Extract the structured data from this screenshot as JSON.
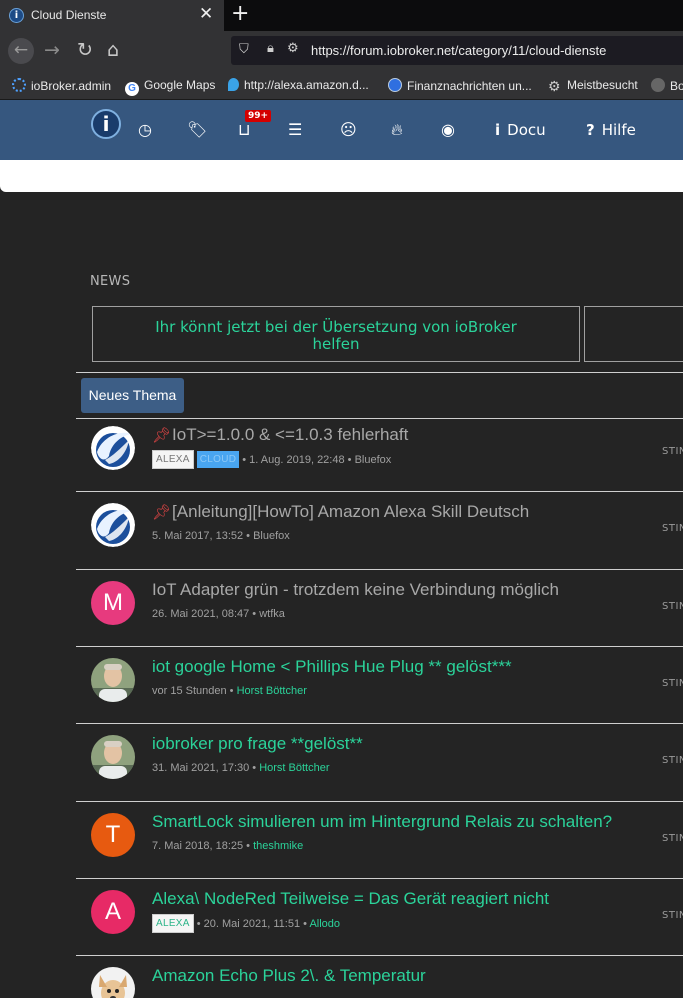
{
  "browser": {
    "tab_title": "Cloud Dienste",
    "url": "https://forum.iobroker.net/category/11/cloud-dienste",
    "bookmarks": [
      {
        "label": "ioBroker.admin",
        "icon": "gear-icon",
        "color": "#4ea1ff"
      },
      {
        "label": "Google Maps",
        "icon": "google-icon",
        "color": "#ffffff"
      },
      {
        "label": "http://alexa.amazon.d...",
        "icon": "location-pin-icon",
        "color": "#3aa3e8"
      },
      {
        "label": "Finanznachrichten un...",
        "icon": "finance-icon",
        "color": "#2f6fe0"
      },
      {
        "label": "Meistbesucht",
        "icon": "gear-icon",
        "color": "#cccccc"
      },
      {
        "label": "Bo",
        "icon": "globe-icon",
        "color": "#888888"
      }
    ]
  },
  "header": {
    "badge": "99+",
    "docu_label": "Docu",
    "hilfe_label": "Hilfe"
  },
  "news": {
    "label": "NEWS",
    "text": "Ihr könnt jetzt bei der Übersetzung von ioBroker helfen"
  },
  "new_topic_label": "Neues Thema",
  "topics": [
    {
      "title": "IoT>=1.0.0 & <=1.0.3 fehlerhaft",
      "pinned": true,
      "unread": false,
      "tags": [
        "ALEXA",
        "CLOUD"
      ],
      "timestamp": "1. Aug. 2019, 22:48",
      "author": "Bluefox",
      "avatar_type": "logo",
      "right": "STIN"
    },
    {
      "title": "[Anleitung][HowTo] Amazon Alexa Skill Deutsch",
      "pinned": true,
      "unread": false,
      "tags": [],
      "timestamp": "5. Mai 2017, 13:52",
      "author": "Bluefox",
      "avatar_type": "logo",
      "right": "STIN"
    },
    {
      "title": "IoT Adapter grün - trotzdem keine Verbindung möglich",
      "pinned": false,
      "unread": false,
      "tags": [],
      "timestamp": "26. Mai 2021, 08:47",
      "author": "wtfka",
      "avatar_type": "letter",
      "avatar_letter": "M",
      "avatar_color": "#e73a7e",
      "right": "STIN"
    },
    {
      "title": "iot google Home < Phillips Hue Plug ** gelöst***",
      "pinned": false,
      "unread": true,
      "tags": [],
      "timestamp": "vor 15 Stunden",
      "author": "Horst Böttcher",
      "avatar_type": "photo",
      "right": "STIN"
    },
    {
      "title": "iobroker pro frage **gelöst**",
      "pinned": false,
      "unread": true,
      "tags": [],
      "timestamp": "31. Mai 2021, 17:30",
      "author": "Horst Böttcher",
      "avatar_type": "photo",
      "right": "STIN"
    },
    {
      "title": "SmartLock simulieren um im Hintergrund Relais zu schalten?",
      "pinned": false,
      "unread": true,
      "tags": [],
      "timestamp": "7. Mai 2018, 18:25",
      "author": "theshmike",
      "avatar_type": "letter",
      "avatar_letter": "T",
      "avatar_color": "#e75a10",
      "right": "STIN"
    },
    {
      "title": "Alexa\\ NodeRed Teilweise = Das Gerät reagiert nicht",
      "pinned": false,
      "unread": true,
      "tags": [
        "ALEXA"
      ],
      "timestamp": "20. Mai 2021, 11:51",
      "author": "Allodo",
      "avatar_type": "letter",
      "avatar_letter": "A",
      "avatar_color": "#e72a66",
      "right": "STIN"
    },
    {
      "title": "Amazon Echo Plus 2\\. & Temperatur",
      "pinned": false,
      "unread": true,
      "tags": [],
      "timestamp": "",
      "author": "",
      "avatar_type": "dog",
      "right": ""
    }
  ]
}
